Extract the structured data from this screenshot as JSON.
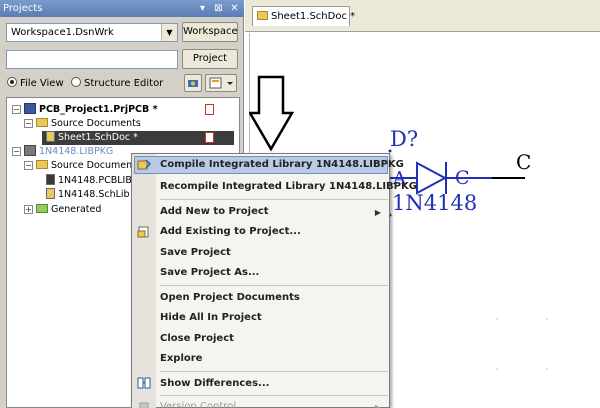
{
  "panel": {
    "title": "Projects",
    "title_controls": [
      "▾",
      "⊠",
      "✕"
    ],
    "workspace_combo": "Workspace1.DsnWrk",
    "workspace_button": "Workspace",
    "project_button": "Project",
    "view_options": [
      {
        "label": "File View",
        "selected": true
      },
      {
        "label": "Structure Editor",
        "selected": false
      }
    ]
  },
  "tree": {
    "items": [
      {
        "label": "PCB_Project1.PrjPCB *",
        "expander": "−"
      },
      {
        "label": "Source Documents",
        "expander": "−"
      },
      {
        "label": "Sheet1.SchDoc *"
      },
      {
        "label": "1N4148.LIBPKG",
        "expander": "−"
      },
      {
        "label": "Source Documents",
        "expander": "−"
      },
      {
        "label": "1N4148.PCBLIB"
      },
      {
        "label": "1N4148.SchLib"
      },
      {
        "label": "Generated",
        "expander": "+"
      }
    ]
  },
  "document": {
    "tab_label": "Sheet1.SchDoc *"
  },
  "schematic": {
    "designator": "D?",
    "pin_a": "A",
    "pin_c_label": "C",
    "net_c": "C",
    "comment": "1N4148",
    "wire_color": "#1f2fb8"
  },
  "context_menu": {
    "items": [
      {
        "label": "Compile Integrated Library 1N4148.LIBPKG",
        "highlighted": true
      },
      {
        "label": "Recompile Integrated Library 1N4148.LIBPKG"
      },
      {
        "label": "Add New to Project",
        "submenu": true
      },
      {
        "label": "Add Existing to Project..."
      },
      {
        "label": "Save Project"
      },
      {
        "label": "Save Project As..."
      },
      {
        "label": "Open Project Documents"
      },
      {
        "label": "Hide All In Project"
      },
      {
        "label": "Close Project"
      },
      {
        "label": "Explore"
      },
      {
        "label": "Show Differences..."
      },
      {
        "label": "Version Control",
        "submenu": true,
        "disabled": true
      }
    ]
  },
  "colors": {
    "panel_bg": "#d4d0c8",
    "title_bar": "#5a7cb4",
    "menu_highlight": "#b9cbe4"
  }
}
